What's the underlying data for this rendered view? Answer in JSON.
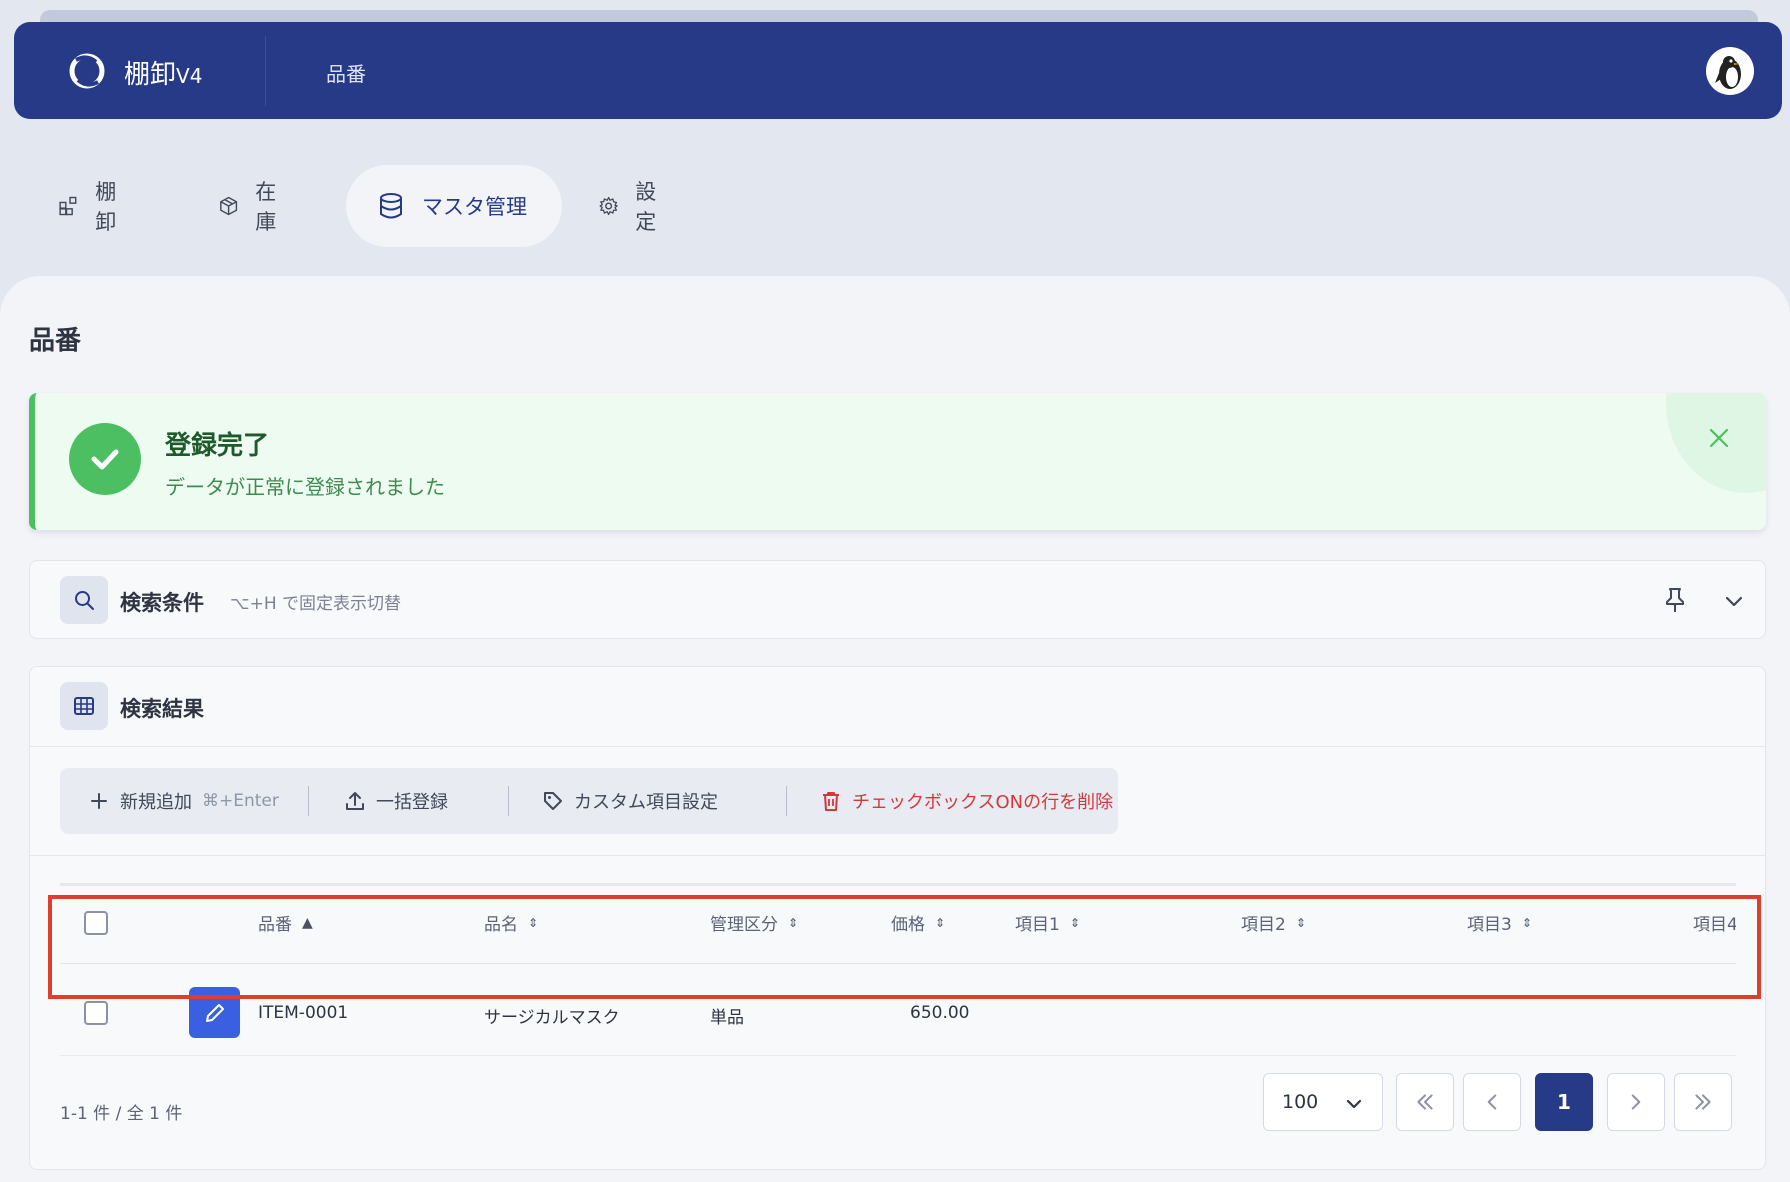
{
  "header": {
    "brand_name": "棚卸",
    "brand_version": "V4",
    "title": "品番"
  },
  "nav": {
    "items": [
      {
        "label": "棚卸",
        "icon": "inventory-icon"
      },
      {
        "label": "在庫",
        "icon": "box-icon"
      },
      {
        "label": "マスタ管理",
        "icon": "database-icon",
        "active": true
      },
      {
        "label": "設定",
        "icon": "gear-icon"
      }
    ]
  },
  "page": {
    "title": "品番"
  },
  "alert": {
    "title": "登録完了",
    "message": "データが正常に登録されました",
    "color": "#4cbf62"
  },
  "search": {
    "label": "検索条件",
    "hint": "⌥+H で固定表示切替"
  },
  "results": {
    "label": "検索結果",
    "toolbar": {
      "add_label": "新規追加",
      "add_shortcut": "⌘+Enter",
      "bulk_label": "一括登録",
      "custom_label": "カスタム項目設定",
      "delete_label": "チェックボックスONの行を削除"
    },
    "columns": [
      "品番",
      "品名",
      "管理区分",
      "価格",
      "項目1",
      "項目2",
      "項目3",
      "項目4"
    ],
    "rows": [
      {
        "code": "ITEM-0001",
        "name": "サージカルマスク",
        "category": "単品",
        "price": "650.00"
      }
    ],
    "count_text": "1-1 件 / 全 1 件",
    "page_size": "100",
    "current_page": "1"
  },
  "colors": {
    "primary": "#263a88",
    "success": "#4cbf62",
    "danger": "#d23a3a",
    "edit_button": "#3a5fe0",
    "highlight": "#e03e2d"
  }
}
